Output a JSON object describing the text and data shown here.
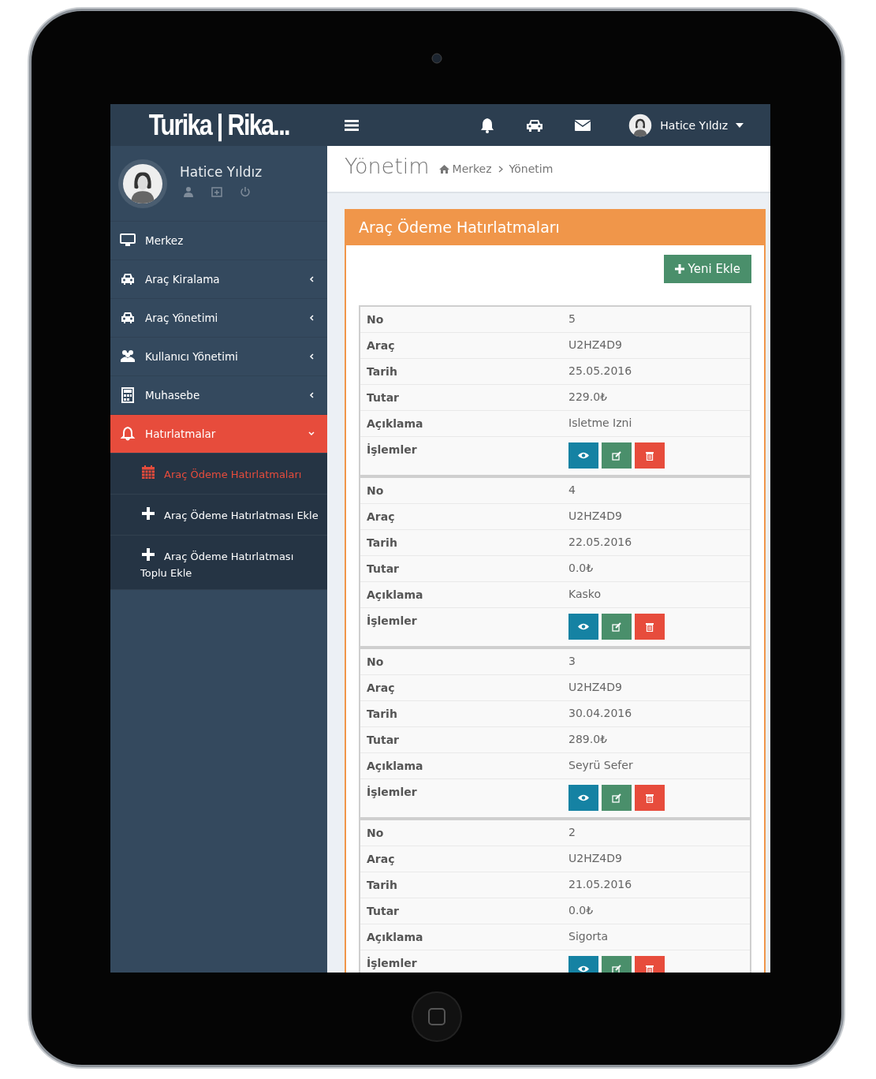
{
  "sidebar": {
    "logo": "Turika | Rika...",
    "user": {
      "name": "Hatice Yıldız"
    },
    "menu": [
      {
        "label": "Merkez",
        "caret": false,
        "selected": false,
        "expanded": false
      },
      {
        "label": "Araç Kiralama",
        "caret": true,
        "selected": false,
        "expanded": false
      },
      {
        "label": "Araç Yönetimi",
        "caret": true,
        "selected": false,
        "expanded": false
      },
      {
        "label": "Kullanıcı Yönetimi",
        "caret": true,
        "selected": false,
        "expanded": false
      },
      {
        "label": "Muhasebe",
        "caret": true,
        "selected": false,
        "expanded": false
      },
      {
        "label": "Hatırlatmalar",
        "caret": true,
        "selected": true,
        "expanded": true,
        "children": [
          {
            "label": "Araç Ödeme Hatırlatmaları",
            "selected": true
          },
          {
            "label": "Araç Ödeme Hatırlatması Ekle",
            "selected": false
          },
          {
            "label": "Araç Ödeme Hatırlatması Toplu Ekle",
            "selected": false
          }
        ]
      }
    ]
  },
  "topbar": {
    "user_name": "Hatice Yıldız"
  },
  "header": {
    "title": "Yönetim",
    "breadcrumb": [
      "Merkez",
      "Yönetim"
    ]
  },
  "card": {
    "title": "Araç Ödeme Hatırlatmaları",
    "add_button": "Yeni Ekle",
    "records": [
      {
        "rows": [
          {
            "kind": "text",
            "label": "No",
            "value": "5"
          },
          {
            "kind": "text",
            "label": "Araç",
            "value": "U2HZ4D9"
          },
          {
            "kind": "text",
            "label": "Tarih",
            "value": "25.05.2016"
          },
          {
            "kind": "text",
            "label": "Tutar",
            "value": "229.0₺"
          },
          {
            "kind": "text",
            "label": "Açıklama",
            "value": "Isletme Izni"
          },
          {
            "kind": "actions",
            "label": "İşlemler"
          }
        ]
      },
      {
        "rows": [
          {
            "kind": "text",
            "label": "No",
            "value": "4"
          },
          {
            "kind": "text",
            "label": "Araç",
            "value": "U2HZ4D9"
          },
          {
            "kind": "text",
            "label": "Tarih",
            "value": "22.05.2016"
          },
          {
            "kind": "text",
            "label": "Tutar",
            "value": "0.0₺"
          },
          {
            "kind": "text",
            "label": "Açıklama",
            "value": "Kasko"
          },
          {
            "kind": "actions",
            "label": "İşlemler"
          }
        ]
      },
      {
        "rows": [
          {
            "kind": "text",
            "label": "No",
            "value": "3"
          },
          {
            "kind": "text",
            "label": "Araç",
            "value": "U2HZ4D9"
          },
          {
            "kind": "text",
            "label": "Tarih",
            "value": "30.04.2016"
          },
          {
            "kind": "text",
            "label": "Tutar",
            "value": "289.0₺"
          },
          {
            "kind": "text",
            "label": "Açıklama",
            "value": "Seyrü Sefer"
          },
          {
            "kind": "actions",
            "label": "İşlemler"
          }
        ]
      },
      {
        "rows": [
          {
            "kind": "text",
            "label": "No",
            "value": "2"
          },
          {
            "kind": "text",
            "label": "Araç",
            "value": "U2HZ4D9"
          },
          {
            "kind": "text",
            "label": "Tarih",
            "value": "21.05.2016"
          },
          {
            "kind": "text",
            "label": "Tutar",
            "value": "0.0₺"
          },
          {
            "kind": "text",
            "label": "Açıklama",
            "value": "Sigorta"
          },
          {
            "kind": "actions",
            "label": "İşlemler"
          }
        ]
      }
    ]
  }
}
